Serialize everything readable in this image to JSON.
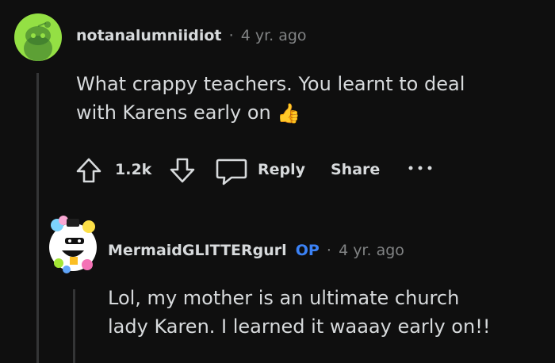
{
  "comment1": {
    "username": "notanalumniidiot",
    "separator": "·",
    "age": "4 yr. ago",
    "text_line1": "What crappy teachers. You learnt to deal",
    "text_line2": "with Karens early on",
    "emoji": "👍",
    "vote_count": "1.2k",
    "reply_label": "Reply",
    "share_label": "Share",
    "more_label": "···"
  },
  "comment2": {
    "username": "MermaidGLITTERgurl",
    "op_badge": "OP",
    "separator": "·",
    "age": "4 yr. ago",
    "text_line1": "Lol, my mother is an ultimate church",
    "text_line2": "lady Karen. I learned it waaay early on!!"
  },
  "colors": {
    "background": "#0f0f0f",
    "text": "#d7dadc",
    "muted": "#818384",
    "op": "#3b82f6",
    "avatar_green": "#94e044"
  }
}
